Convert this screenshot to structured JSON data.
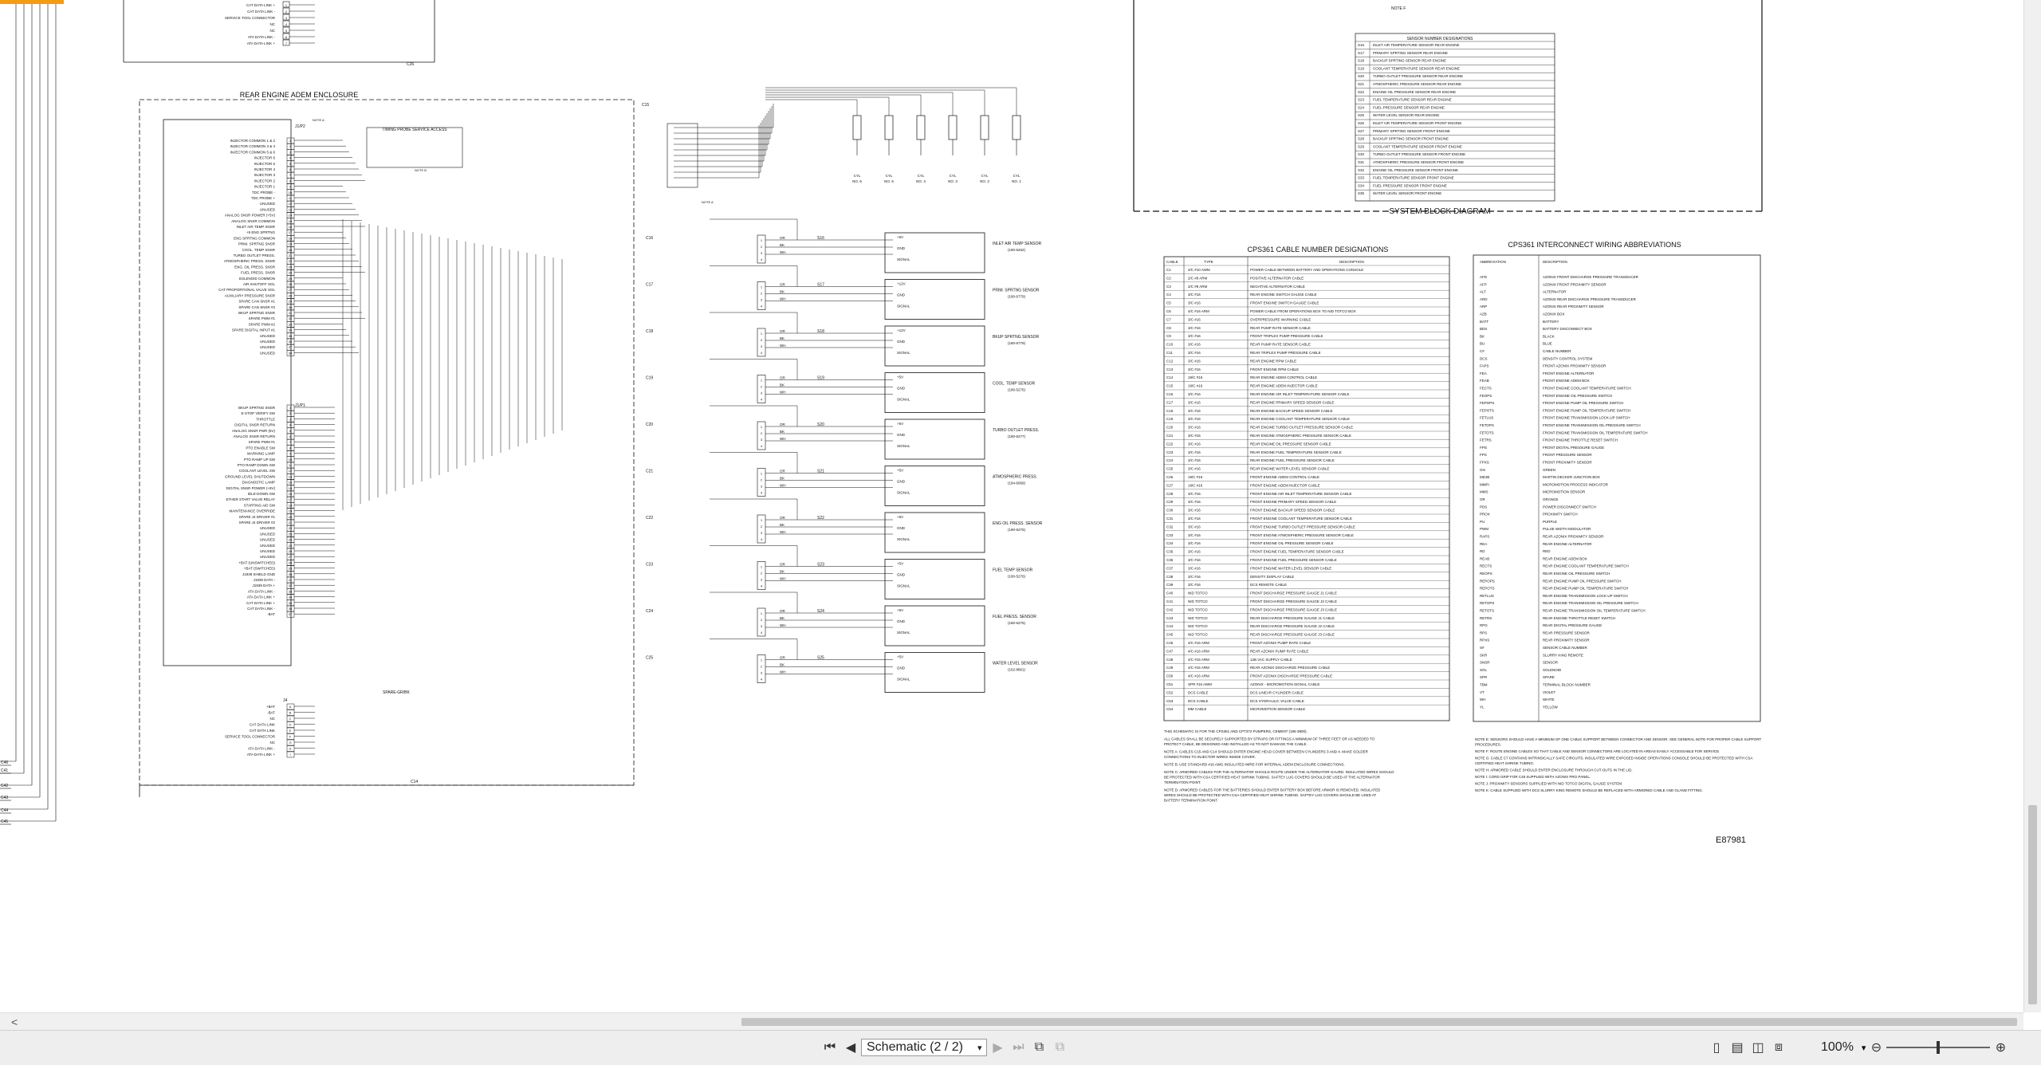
{
  "toolbar": {
    "prev_arrow": "<",
    "page_label": "Schematic (2 / 2)",
    "zoom": "100%"
  },
  "doc": {
    "notes_f": "NOTE F",
    "sensor_table_title": "SENSOR NUMBER DESIGNATIONS",
    "sensor_table": [
      [
        "S16",
        "INLET AIR TEMPERATURE SENSOR REAR ENGINE"
      ],
      [
        "S17",
        "PRIMARY SPRTING SENSOR REAR ENGINE"
      ],
      [
        "S18",
        "BACKUP SPRTING SENSOR REAR ENGINE"
      ],
      [
        "S19",
        "COOLANT TEMPERATURE SENSOR REAR ENGINE"
      ],
      [
        "S20",
        "TURBO OUTLET PRESSURE SENSOR REAR ENGINE"
      ],
      [
        "S21",
        "ATMOSPHERIC PRESSURE SENSOR REAR ENGINE"
      ],
      [
        "S22",
        "ENGINE OIL PRESSURE SENSOR REAR ENGINE"
      ],
      [
        "S23",
        "FUEL TEMPERATURE SENSOR REAR ENGINE"
      ],
      [
        "S24",
        "FUEL PRESSURE SENSOR REAR ENGINE"
      ],
      [
        "S25",
        "WATER LEVEL SENSOR REAR ENGINE"
      ],
      [
        "S26",
        "INLET AIR TEMPERATURE SENSOR FRONT ENGINE"
      ],
      [
        "S27",
        "PRIMARY SPRTING SENSOR FRONT ENGINE"
      ],
      [
        "S28",
        "BACKUP SPRTING SENSOR FRONT ENGINE"
      ],
      [
        "S29",
        "COOLANT TEMPERATURE SENSOR FRONT ENGINE"
      ],
      [
        "S30",
        "TURBO OUTLET PRESSURE SENSOR FRONT ENGINE"
      ],
      [
        "S31",
        "ATMOSPHERIC PRESSURE SENSOR FRONT ENGINE"
      ],
      [
        "S32",
        "ENGINE OIL PRESSURE SENSOR FRONT ENGINE"
      ],
      [
        "S33",
        "FUEL TEMPERATURE SENSOR FRONT ENGINE"
      ],
      [
        "S34",
        "FUEL PRESSURE SENSOR FRONT ENGINE"
      ],
      [
        "S35",
        "WATER LEVEL SENSOR FRONT ENGINE"
      ]
    ],
    "system_block": "SYSTEM BLOCK DIAGRAM",
    "enclosure_title": "REAR ENGINE ADEM ENCLOSURE",
    "timing_probe": "TIMING PROBE SERVICE ACCESS",
    "service_tool": "SERVICE TOOL CONNECTOR",
    "cable_table_title": "CPS361 CABLE NUMBER DESIGNATIONS",
    "cable_headers": [
      "CABLE",
      "TYPE",
      "DESCRIPTION"
    ],
    "cables": [
      [
        "C1",
        "2/C #10 AWM",
        "POWER CABLE BETWEEN BATTERY AND OPERATIONS CONSOLE"
      ],
      [
        "C2",
        "2/C #8 ARM",
        "POSITIVE ALTERNATOR CABLE"
      ],
      [
        "C3",
        "2/C #8 ARM",
        "NEGATIVE ALTERNATOR CABLE"
      ],
      [
        "C4",
        "3/C #16",
        "REAR ENGINE SWITCH GAUGE CABLE"
      ],
      [
        "C5",
        "3/C #16",
        "FRONT ENGINE SWITCH GAUGE CABLE"
      ],
      [
        "C6",
        "4/C #16 ARM",
        "POWER CABLE FROM OPERATIONS BOX TO NID TOTCO BOX"
      ],
      [
        "C7",
        "3/C #16",
        "OVERPRESSURE WARNING CABLE"
      ],
      [
        "C8",
        "3/C #16",
        "REAR PUMP RATE SENSOR CABLE"
      ],
      [
        "C9",
        "3/C #16",
        "FRONT TRIPLEX PUMP PRESSURE CABLE"
      ],
      [
        "C10",
        "3/C #16",
        "REAR PUMP RATE SENSOR CABLE"
      ],
      [
        "C11",
        "3/C #16",
        "REAR TRIPLEX PUMP PRESSURE CABLE"
      ],
      [
        "C12",
        "3/C #16",
        "REAR ENGINE RPM CABLE"
      ],
      [
        "C13",
        "3/C #16",
        "FRONT ENGINE RPM CABLE"
      ],
      [
        "C14",
        "19/C #16",
        "REAR ENGINE ADEM CONTROL CABLE"
      ],
      [
        "C15",
        "19/C #16",
        "REAR ENGINE ADEM INJECTOR CABLE"
      ],
      [
        "C16",
        "3/C #16",
        "REAR ENGINE AIR INLET TEMPERATURE SENSOR CABLE"
      ],
      [
        "C17",
        "3/C #16",
        "REAR ENGINE PRIMARY SPEED SENSOR CABLE"
      ],
      [
        "C18",
        "3/C #16",
        "REAR ENGINE BACKUP SPEED SENSOR CABLE"
      ],
      [
        "C19",
        "3/C #16",
        "REAR ENGINE COOLANT TEMPERATURE SENSOR CABLE"
      ],
      [
        "C20",
        "3/C #16",
        "REAR ENGINE TURBO OUTLET PRESSURE SENSOR CABLE"
      ],
      [
        "C21",
        "3/C #16",
        "REAR ENGINE ATMOSPHERIC PRESSURE SENSOR CABLE"
      ],
      [
        "C22",
        "3/C #16",
        "REAR ENGINE OIL PRESSURE SENSOR CABLE"
      ],
      [
        "C23",
        "3/C #16",
        "REAR ENGINE FUEL TEMPERATURE SENSOR CABLE"
      ],
      [
        "C24",
        "3/C #16",
        "REAR ENGINE FUEL PRESSURE SENSOR CABLE"
      ],
      [
        "C25",
        "3/C #16",
        "REAR ENGINE WATER LEVEL SENSOR CABLE"
      ],
      [
        "C26",
        "19/C #16",
        "FRONT ENGINE ADEM CONTROL CABLE"
      ],
      [
        "C27",
        "19/C #16",
        "FRONT ENGINE ADEM INJECTOR CABLE"
      ],
      [
        "C28",
        "3/C #16",
        "FRONT ENGINE AIR INLET TEMPERATURE SENSOR CABLE"
      ],
      [
        "C29",
        "3/C #16",
        "FRONT ENGINE PRIMARY SPEED SENSOR CABLE"
      ],
      [
        "C30",
        "3/C #16",
        "FRONT ENGINE BACKUP SPEED SENSOR CABLE"
      ],
      [
        "C31",
        "3/C #16",
        "FRONT ENGINE COOLANT TEMPERATURE SENSOR CABLE"
      ],
      [
        "C32",
        "3/C #16",
        "FRONT ENGINE TURBO OUTLET PRESSURE SENSOR CABLE"
      ],
      [
        "C33",
        "3/C #16",
        "FRONT ENGINE ATMOSPHERIC PRESSURE SENSOR CABLE"
      ],
      [
        "C34",
        "3/C #16",
        "FRONT ENGINE OIL PRESSURE SENSOR CABLE"
      ],
      [
        "C35",
        "3/C #16",
        "FRONT ENGINE FUEL TEMPERATURE SENSOR CABLE"
      ],
      [
        "C36",
        "3/C #16",
        "FRONT ENGINE FUEL PRESSURE SENSOR CABLE"
      ],
      [
        "C37",
        "3/C #16",
        "FRONT ENGINE WATER LEVEL SENSOR CABLE"
      ],
      [
        "C38",
        "3/C #16",
        "DENSITY DISPLAY CABLE"
      ],
      [
        "C39",
        "3/C #16",
        "DCS REMOTE CABLE"
      ],
      [
        "C40",
        "NID TOTCO",
        "FRONT DISCHARGE PRESSURE GAUGE J1 CABLE"
      ],
      [
        "C41",
        "NID TOTCO",
        "FRONT DISCHARGE PRESSURE GAUGE J2 CABLE"
      ],
      [
        "C42",
        "NID TOTCO",
        "FRONT DISCHARGE PRESSURE GAUGE J3 CABLE"
      ],
      [
        "C43",
        "NID TOTCO",
        "REAR DISCHARGE PRESSURE GAUGE J1 CABLE"
      ],
      [
        "C44",
        "NID TOTCO",
        "REAR DISCHARGE PRESSURE GAUGE J2 CABLE"
      ],
      [
        "C45",
        "NID TOTCO",
        "REAR DISCHARGE PRESSURE GAUGE J3 CABLE"
      ],
      [
        "C46",
        "4/C #16 ARM",
        "FRONT AZONIX PUMP RATE CABLE"
      ],
      [
        "C47",
        "4/C #16 ARM",
        "REAR AZONIX PUMP RATE CABLE"
      ],
      [
        "C48",
        "4/C #16 ARM",
        "12B VAC SUPPLY CABLE"
      ],
      [
        "C49",
        "4/C #16 ARM",
        "REAR AZONIX DISCHARGE PRESSURE CABLE"
      ],
      [
        "C50",
        "4/C #16 ARM",
        "FRONT AZONIX DISCHARGE PRESSURE CABLE"
      ],
      [
        "C51",
        "SPR #16 AWM",
        "AZONIX - MICROMOTION SIGNAL CABLE"
      ],
      [
        "C52",
        "DCS CABLE",
        "DCS LINEAR CYLINDER CABLE"
      ],
      [
        "C53",
        "DCS CABLE",
        "DCS HYDRAULIC VALVE CABLE"
      ],
      [
        "C54",
        "MM CABLE",
        "MICROMOTION SENSOR CABLE"
      ]
    ],
    "abbr_table_title": "CPS361 INTERCONNECT WIRING ABBREVIATIONS",
    "abbr_headers": [
      "ABBREVIATION",
      "DESCRIPTION"
    ],
    "abbrs": [
      [
        "AFD",
        "AZONIX FRONT DISCHARGE PRESSURE TRANSDUCER"
      ],
      [
        "AFP",
        "AZONIX FRONT PROXIMITY SENSOR"
      ],
      [
        "ALT",
        "ALTERNATOR"
      ],
      [
        "ARD",
        "AZONIX REAR DISCHARGE PRESSURE TRANSDUCER"
      ],
      [
        "ARP",
        "AZONIX REAR PROXIMITY SENSOR"
      ],
      [
        "AZB",
        "AZONIX BOX"
      ],
      [
        "BATT",
        "BATTERY"
      ],
      [
        "BDS",
        "BATTERY DISCONNECT BOX"
      ],
      [
        "BK",
        "BLACK"
      ],
      [
        "BU",
        "BLUE"
      ],
      [
        "C#",
        "CABLE NUMBER"
      ],
      [
        "DCS",
        "DENSITY CONTROL SYSTEM"
      ],
      [
        "FAPS",
        "FRONT AZONIX PROXIMITY SENSOR"
      ],
      [
        "FEA",
        "FRONT ENGINE ALTERNATOR"
      ],
      [
        "FEAB",
        "FRONT ENGINE ADEM BOX"
      ],
      [
        "FECTS",
        "FRONT ENGINE COOLANT TEMPERATURE SWITCH"
      ],
      [
        "FEOPS",
        "FRONT ENGINE OIL PRESSURE SWITCH"
      ],
      [
        "FEPOPS",
        "FRONT ENGINE PUMP OIL PRESSURE SWITCH"
      ],
      [
        "FEPOTS",
        "FRONT ENGINE PUMP OIL TEMPERATURE SWITCH"
      ],
      [
        "FETLUS",
        "FRONT ENGINE TRANSMISSION LOCK-UP SWITCH"
      ],
      [
        "FETOPS",
        "FRONT ENGINE TRANSMISSION OIL PRESSURE SWITCH"
      ],
      [
        "FETOTS",
        "FRONT ENGINE TRANSMISSION OIL TEMPERATURE SWITCH"
      ],
      [
        "FETRS",
        "FRONT ENGINE THROTTLE RESET SWITCH"
      ],
      [
        "FPG",
        "FRONT DIGITAL PRESSURE GAUGE"
      ],
      [
        "FPS",
        "FRONT PRESSURE SENSOR"
      ],
      [
        "FPXS",
        "FRONT PROXIMITY SENSOR"
      ],
      [
        "GN",
        "GREEN"
      ],
      [
        "MDJB",
        "MARTIN DECKER JUNCTION BOX"
      ],
      [
        "MMPI",
        "MICROMOTION PROCESS INDICATOR"
      ],
      [
        "MMS",
        "MICROMOTION SENSOR"
      ],
      [
        "OR",
        "ORANGE"
      ],
      [
        "PDS",
        "POWER DISCONNECT SWITCH"
      ],
      [
        "PROX",
        "PROXIMITY SWITCH"
      ],
      [
        "PU",
        "PURPLE"
      ],
      [
        "PWM",
        "PULSE WIDTH MODULATOR"
      ],
      [
        "RAPS",
        "REAR AZONIX PROXIMITY SENSOR"
      ],
      [
        "REA",
        "REAR ENGINE ALTERNATOR"
      ],
      [
        "RD",
        "RED"
      ],
      [
        "REAB",
        "REAR ENGINE ADEM BOX"
      ],
      [
        "RECTS",
        "REAR ENGINE COOLANT TEMPERATURE SWITCH"
      ],
      [
        "REOPS",
        "REAR ENGINE OIL PRESSURE SWITCH"
      ],
      [
        "REPOPS",
        "REAR ENGINE PUMP OIL PRESSURE SWITCH"
      ],
      [
        "REPOTS",
        "REAR ENGINE PUMP OIL TEMPERATURE SWITCH"
      ],
      [
        "RETLUS",
        "REAR ENGINE TRANSMISSION LOCK-UP SWITCH"
      ],
      [
        "RETOPS",
        "REAR ENGINE TRANSMISSION OIL PRESSURE SWITCH"
      ],
      [
        "RETOTS",
        "REAR ENGINE TRANSMISSION OIL TEMPERATURE SWITCH"
      ],
      [
        "RETRS",
        "REAR ENGINE THROTTLE RESET SWITCH"
      ],
      [
        "RPG",
        "REAR DIGITAL PRESSURE GAUGE"
      ],
      [
        "RPS",
        "REAR PRESSURE SENSOR"
      ],
      [
        "RPXS",
        "REAR PROXIMITY SENSOR"
      ],
      [
        "S#",
        "SENSOR CABLE NUMBER"
      ],
      [
        "SKR",
        "SLURRY KING REMOTE"
      ],
      [
        "SNSR",
        "SENSOR"
      ],
      [
        "SOL",
        "SOLENOID"
      ],
      [
        "SPR",
        "SPARE"
      ],
      [
        "TBM",
        "TERMINAL BLOCK NUMBER"
      ],
      [
        "VT",
        "VIOLET"
      ],
      [
        "WH",
        "WHITE"
      ],
      [
        "YL",
        "YELLOW"
      ]
    ],
    "sensors": [
      [
        "INLET AIR TEMP SENSOR",
        "(180-5262)"
      ],
      [
        "PRIM. SPRTNG SENSOR",
        "(180-6779)"
      ],
      [
        "BKUP SPRTNG SENSOR",
        "(180-6779)"
      ],
      [
        "COOL. TEMP SENSOR",
        "(180-5276)"
      ],
      [
        "TURBO OUTLET PRESS.",
        "(180-6277)"
      ],
      [
        "ATMOSPHERIC PRESS.",
        "(194-6069)"
      ],
      [
        "ENG OIL PRESS. SENSOR",
        "(180-6275)"
      ],
      [
        "FUEL TEMP SENSOR",
        "(180-5276)"
      ],
      [
        "FUEL PRESS. SENSOR",
        "(180-6275)"
      ],
      [
        "WATER LEVEL SENSOR",
        "(162-8861)"
      ]
    ],
    "sensor_pins": [
      "+5V",
      "GND",
      "SIGNAL"
    ],
    "sensor_pins_12": [
      "+12V",
      "GND",
      "SIGNAL"
    ],
    "cylinders": [
      "CYL NO. 6",
      "CYL NO. 5",
      "CYL NO. 4",
      "CYL NO. 3",
      "CYL NO. 2",
      "CYL NO. 1"
    ],
    "cable_labels": [
      "C16",
      "C17",
      "C18",
      "C19",
      "C20",
      "C21",
      "C22",
      "C23",
      "C24",
      "C25"
    ],
    "left_pins_a": [
      "INJECTOR COMMON 1 & 2",
      "INJECTOR COMMON 3 & 4",
      "INJECTOR COMMON 5 & 6",
      "INJECTOR 6",
      "INJECTOR 5",
      "INJECTOR 4",
      "INJECTOR 3",
      "INJECTOR 2",
      "INJECTOR 1",
      "TDC PROBE -",
      "TDC PROBE +",
      "UNUSED",
      "UNUSED",
      "ANALOG SNSR POWER (+5V)",
      "ANALOG SNSR COMMON",
      "INLET AIR TEMP SNSR",
      "+5 ENG SPRTNG",
      "ENG SPRTNG COMMON",
      "PRIM. SPRTNG SNSR",
      "COOL. TEMP SNSR",
      "TURBO OUTLET PRESS.",
      "ATMOSPHERIC PRESS. SNSR",
      "ENG. OIL PRESS. SNSR",
      "FUEL PRESS. SNSR",
      "SOLENOID COMMON",
      "AIR SHUTOFF SOL",
      "CAT PROPORTIONAL VALVE SOL",
      "AUXILIARY PRESSURE SNSR",
      "SPARE CAN SNSR #1",
      "SPARE CAN SNSR #2",
      "BKUP SPRTNG SNSR",
      "SPARE PWM #1",
      "SPARE PWM #2",
      "SPARE DIGITAL INPUT #1",
      "UNUSED",
      "UNUSED",
      "UNUSED",
      "UNUSED"
    ],
    "left_pins_b": [
      "BKUP SPRTNG SNSR",
      "E-STOP VERIFY SW",
      "THROTTLE",
      "DIGITAL SNSR RETURN",
      "ANALOG SNSR PWR (5V)",
      "ANALOG SNSR RETURN",
      "SPARE PWM #1",
      "PTO ENABLE SW",
      "WARNING LAMP",
      "PTO RAMP UP SW",
      "PTO RAMP DOWN SW",
      "COOLANT LEVEL SW",
      "GROUND LEVEL SHUTDOWN",
      "DIAGNOSTIC LAMP",
      "DIGITAL SNSR POWER (+8V)",
      "IDLE-DOWN SW",
      "ETHER START VALVE RELAY",
      "STARTING AID SW",
      "MAINTENANCE OVERRIDE",
      "SPARE J4 DRIVER #1",
      "SPARE J4 DRIVER #2",
      "UNUSED",
      "UNUSED",
      "UNUSED",
      "UNUSED",
      "UNUSED",
      "UNUSED",
      "+BAT (UNSWITCHED)",
      "+BAT (SWITCHED)",
      "J1939 SHIELD GND",
      "J1939 DATA -",
      "J1939 DATA +",
      "ATA DATA LINK -",
      "ATA DATA LINK +",
      "CAT DATA LINK +",
      "CAT DATA LINK -",
      "-BAT"
    ],
    "notes_block": [
      "THIS SCHEMATIC IS FOR THE CPS361 AND CPT372 PUMPERS, CEMENT (195-3800).",
      "ALL CABLES SHALL BE SECURELY SUPPORTED BY STRAPS OR FITTINGS A MINIMUM OF THREE FEET OR AS NEEDED TO PROTECT CABLE, BE DESIGNED AND INSTALLED AS TO NOT DAMAGE THE CABLE.",
      "NOTE A:  CABLES C15 AND C14 SHOULD ENTER ENGINE HEAD COVER BETWEEN CYLINDERS 3 AND 4. MAKE SOLDER CONNECTIONS TO INJECTOR WIRES INSIDE COVER.",
      "NOTE B:  USE STANDARD #16 AWG INSULATED WIRE FOR INTERNAL ADEM ENCLOSURE CONNECTIONS.",
      "NOTE C:  ARMORED CABLES FOR THE ALTERNATOR SHOULD ROUTE UNDER THE ALTERNATOR GAURD. INSULATED WIRES SHOULD BE PROTECTED WITH CSA CERTIFIED HEAT SHRINK TUBING. SAFTEY LUG COVERS SHOULD BE USED AT THE ALTERNATOR TERMINATION POINT.",
      "NOTE D:  ARMORED CABLES FOR THE BATTERIES SHOULD ENTER BATTERY BOX BEFORE ARMOR IS REMOVED. INSULATED WIRES SHOULD BE PROTECTED WITH CSA CERTIFIED HEAT SHRINK TUBING. SAFTEY LUG COVERS SHOULD BE USED AT BATTERY TERMINATION POINT."
    ],
    "notes_block2": [
      "NOTE E:  SENSORS SHOULD HAVE A MINIMUM OF ONE CABLE SUPPORT BETWEEN CONNECTOR AND SENSOR. SEE GENERAL NOTE FOR PROPER CABLE SUPPORT PROCEDURES.",
      "NOTE F:  ROUTE ENGINE CABLES SO THAT CABLE AND SENSOR CONNECTORS ARE LOCATED IN AREAS EASILY ACCESSABLE FOR SERVICE.",
      "NOTE G:  CABLE C7 CONTAINS INTRINSICALLY SAFE CIRCUITS. INSULATED WIRE EXPOSED INSIDE OPERATIONS CONSOLE SHOULD BE PROTECTED WITH CSA CERTIFIED HEAT SHRINK TUBING.",
      "NOTE H:  ARMORED CABLE SHOULD ENTER ENCLOSURE THROUGH CUT-OUTS IN THE LID.",
      "NOTE I:  CORD GRIP FOR C49 SUPPLIED WITH AZONIX PRO PANEL.",
      "NOTE J:  PROXIMITY SENSORS SUPPLIED WITH NID TOTCO DIGITAL GAUGE SYSTEM.",
      "NOTE K:  CABLE SUPPLIED WITH DCS SLURRY KING REMOTE SHOULD BE REPLACED WITH ARMORED CABLE AND GLAND FITTING."
    ],
    "drawing_number": "E87981",
    "top_pins": [
      "CAT DATA LINK +",
      "CAT DATA LINK -",
      "SERVICE TOOL CONNECTOR",
      "NC",
      "NC",
      "ATA DATA LINK -",
      "ATA DATA LINK +"
    ],
    "bottom_pins": [
      "+BAT",
      "-BAT",
      "NC",
      "CAT DATA LINK",
      "CAT DATA LINK",
      "SERVICE TOOL CONNECTOR",
      "NC",
      "ATA DATA LINK -",
      "ATA DATA LINK +"
    ],
    "left_edge_labels": [
      "C46",
      "C41",
      "C42",
      "C43",
      "C44",
      "C45"
    ],
    "misc": {
      "j1p2": "J1/P2",
      "j1p1": "J1/P1",
      "j4": "J4",
      "c14": "C14",
      "c15": "C15",
      "c26": "C26",
      "note_a": "NOTE A",
      "note_b": "NOTE B",
      "spare_grbk": "SPARE-GR/BK"
    }
  }
}
